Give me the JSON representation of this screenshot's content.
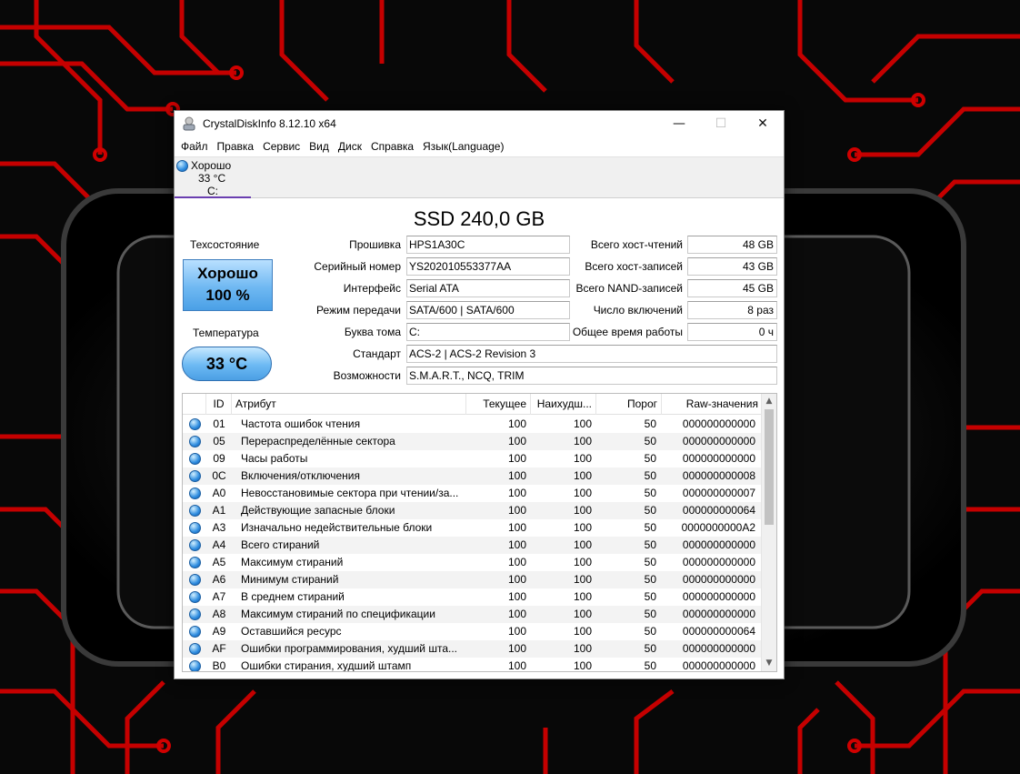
{
  "window": {
    "title": "CrystalDiskInfo 8.12.10 x64",
    "minimize_glyph": "—",
    "maximize_glyph": "☐",
    "close_glyph": "✕"
  },
  "menu": [
    "Файл",
    "Правка",
    "Сервис",
    "Вид",
    "Диск",
    "Справка",
    "Язык(Language)"
  ],
  "drive_tab": {
    "status": "Хорошо",
    "temp": "33 °C",
    "letter": "C:"
  },
  "model": "SSD 240,0 GB",
  "health": {
    "label": "Техсостояние",
    "status": "Хорошо",
    "percent": "100 %"
  },
  "temperature": {
    "label": "Температура",
    "value": "33 °C"
  },
  "info_left": [
    {
      "label": "Прошивка",
      "value": "HPS1A30C"
    },
    {
      "label": "Серийный номер",
      "value": "YS202010553377AA"
    },
    {
      "label": "Интерфейс",
      "value": "Serial ATA"
    },
    {
      "label": "Режим передачи",
      "value": "SATA/600 | SATA/600"
    },
    {
      "label": "Буква тома",
      "value": "C:"
    },
    {
      "label": "Стандарт",
      "value": "ACS-2 | ACS-2 Revision 3"
    },
    {
      "label": "Возможности",
      "value": "S.M.A.R.T., NCQ, TRIM"
    }
  ],
  "info_right": [
    {
      "label": "Всего хост-чтений",
      "value": "48 GB"
    },
    {
      "label": "Всего хост-записей",
      "value": "43 GB"
    },
    {
      "label": "Всего NAND-записей",
      "value": "45 GB"
    },
    {
      "label": "Число включений",
      "value": "8 раз"
    },
    {
      "label": "Общее время работы",
      "value": "0 ч"
    }
  ],
  "table": {
    "headers": {
      "id": "ID",
      "attr": "Атрибут",
      "cur": "Текущее",
      "worst": "Наихудш...",
      "thresh": "Порог",
      "raw": "Raw-значения"
    },
    "rows": [
      {
        "id": "01",
        "attr": "Частота ошибок чтения",
        "cur": "100",
        "worst": "100",
        "thresh": "50",
        "raw": "000000000000"
      },
      {
        "id": "05",
        "attr": "Перераспределённые сектора",
        "cur": "100",
        "worst": "100",
        "thresh": "50",
        "raw": "000000000000"
      },
      {
        "id": "09",
        "attr": "Часы работы",
        "cur": "100",
        "worst": "100",
        "thresh": "50",
        "raw": "000000000000"
      },
      {
        "id": "0C",
        "attr": "Включения/отключения",
        "cur": "100",
        "worst": "100",
        "thresh": "50",
        "raw": "000000000008"
      },
      {
        "id": "A0",
        "attr": "Невосстановимые сектора при чтении/за...",
        "cur": "100",
        "worst": "100",
        "thresh": "50",
        "raw": "000000000007"
      },
      {
        "id": "A1",
        "attr": "Действующие запасные блоки",
        "cur": "100",
        "worst": "100",
        "thresh": "50",
        "raw": "000000000064"
      },
      {
        "id": "A3",
        "attr": "Изначально недействительные блоки",
        "cur": "100",
        "worst": "100",
        "thresh": "50",
        "raw": "0000000000A2"
      },
      {
        "id": "A4",
        "attr": "Всего стираний",
        "cur": "100",
        "worst": "100",
        "thresh": "50",
        "raw": "000000000000"
      },
      {
        "id": "A5",
        "attr": "Максимум стираний",
        "cur": "100",
        "worst": "100",
        "thresh": "50",
        "raw": "000000000000"
      },
      {
        "id": "A6",
        "attr": "Минимум стираний",
        "cur": "100",
        "worst": "100",
        "thresh": "50",
        "raw": "000000000000"
      },
      {
        "id": "A7",
        "attr": "В среднем стираний",
        "cur": "100",
        "worst": "100",
        "thresh": "50",
        "raw": "000000000000"
      },
      {
        "id": "A8",
        "attr": "Максимум стираний по спецификации",
        "cur": "100",
        "worst": "100",
        "thresh": "50",
        "raw": "000000000000"
      },
      {
        "id": "A9",
        "attr": "Оставшийся ресурс",
        "cur": "100",
        "worst": "100",
        "thresh": "50",
        "raw": "000000000064"
      },
      {
        "id": "AF",
        "attr": "Ошибки программирования, худший шта...",
        "cur": "100",
        "worst": "100",
        "thresh": "50",
        "raw": "000000000000"
      },
      {
        "id": "B0",
        "attr": "Ошибки стирания, худший штамп",
        "cur": "100",
        "worst": "100",
        "thresh": "50",
        "raw": "000000000000"
      }
    ]
  },
  "colors": {
    "accent_tab": "#6a3fb0",
    "health_blue": "#6fb8f2",
    "wallpaper_red": "#d40000"
  }
}
